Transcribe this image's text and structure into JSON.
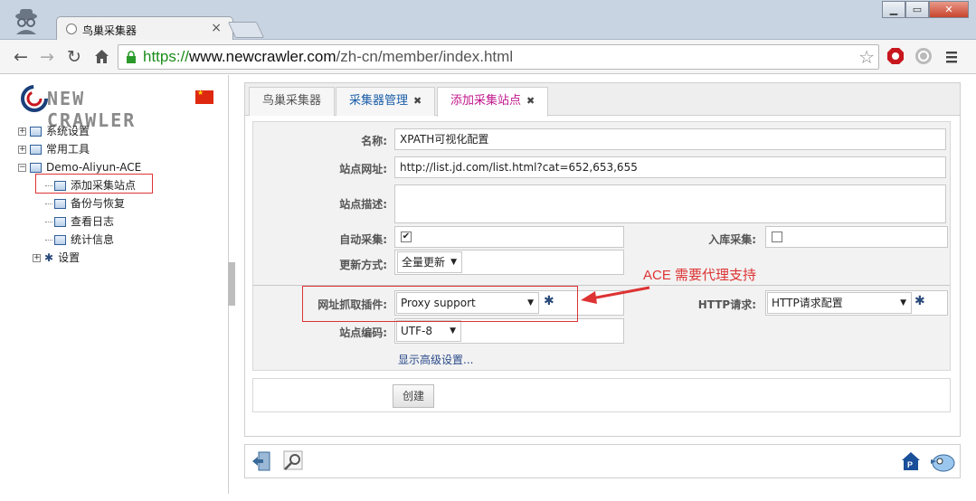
{
  "browser": {
    "tab_title": "鸟巢采集器",
    "tab_close": "×",
    "url_scheme": "https://",
    "url_host": "www.newcrawler.com",
    "url_path": "/zh-cn/member/index.html"
  },
  "sidebar": {
    "logo_text": "NEW CRAWLER",
    "tree": [
      {
        "label": "系统设置",
        "toggle": "+"
      },
      {
        "label": "常用工具",
        "toggle": "+"
      },
      {
        "label": "Demo-Aliyun-ACE",
        "toggle": "−"
      }
    ],
    "children": [
      {
        "label": "添加采集站点"
      },
      {
        "label": "备份与恢复"
      },
      {
        "label": "查看日志"
      },
      {
        "label": "统计信息"
      }
    ],
    "settings": {
      "label": "设置",
      "toggle": "+"
    }
  },
  "tabs": [
    {
      "label": "鸟巢采集器",
      "color": "#555555"
    },
    {
      "label": "采集器管理",
      "color": "#1a5ea8"
    },
    {
      "label": "添加采集站点",
      "color": "#c0178c"
    }
  ],
  "tab_close": "✖",
  "form": {
    "name_label": "名称:",
    "name_value": "XPATH可视化配置",
    "url_label": "站点网址:",
    "url_value": "http://list.jd.com/list.html?cat=652,653,655",
    "desc_label": "站点描述:",
    "desc_value": "",
    "auto_label": "自动采集:",
    "auto_checked": "✔",
    "store_label": "入库采集:",
    "update_label": "更新方式:",
    "update_value": "全量更新",
    "plugin_label": "网址抓取插件:",
    "plugin_value": "Proxy support",
    "http_label": "HTTP请求:",
    "http_value": "HTTP请求配置",
    "encoding_label": "站点编码:",
    "encoding_value": "UTF-8",
    "advanced_link": "显示高级设置...",
    "create_button": "创建"
  },
  "annotation": "ACE 需要代理支持"
}
